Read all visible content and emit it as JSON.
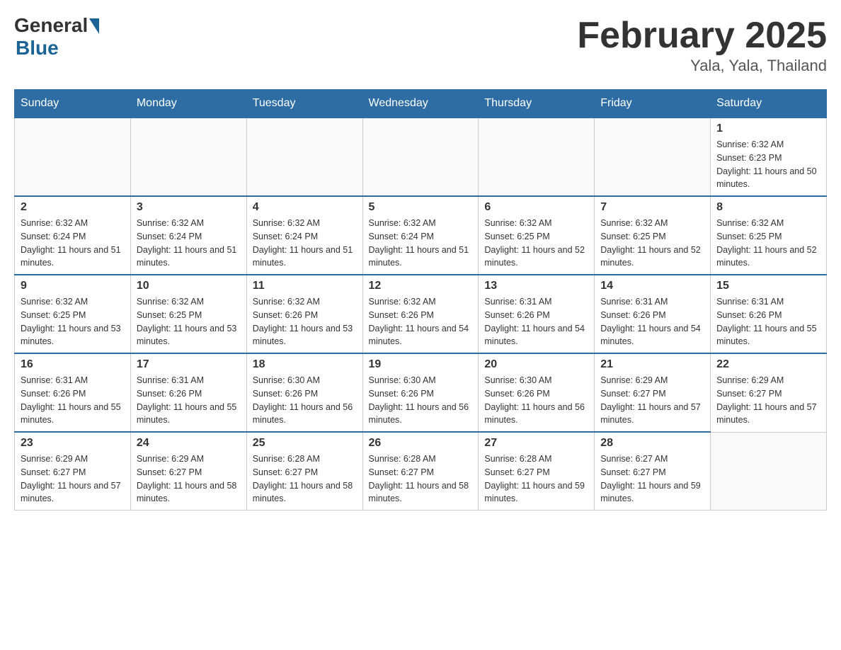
{
  "header": {
    "logo_general": "General",
    "logo_blue": "Blue",
    "month_title": "February 2025",
    "location": "Yala, Yala, Thailand"
  },
  "days_of_week": [
    "Sunday",
    "Monday",
    "Tuesday",
    "Wednesday",
    "Thursday",
    "Friday",
    "Saturday"
  ],
  "weeks": [
    [
      {
        "day": "",
        "info": ""
      },
      {
        "day": "",
        "info": ""
      },
      {
        "day": "",
        "info": ""
      },
      {
        "day": "",
        "info": ""
      },
      {
        "day": "",
        "info": ""
      },
      {
        "day": "",
        "info": ""
      },
      {
        "day": "1",
        "info": "Sunrise: 6:32 AM\nSunset: 6:23 PM\nDaylight: 11 hours and 50 minutes."
      }
    ],
    [
      {
        "day": "2",
        "info": "Sunrise: 6:32 AM\nSunset: 6:24 PM\nDaylight: 11 hours and 51 minutes."
      },
      {
        "day": "3",
        "info": "Sunrise: 6:32 AM\nSunset: 6:24 PM\nDaylight: 11 hours and 51 minutes."
      },
      {
        "day": "4",
        "info": "Sunrise: 6:32 AM\nSunset: 6:24 PM\nDaylight: 11 hours and 51 minutes."
      },
      {
        "day": "5",
        "info": "Sunrise: 6:32 AM\nSunset: 6:24 PM\nDaylight: 11 hours and 51 minutes."
      },
      {
        "day": "6",
        "info": "Sunrise: 6:32 AM\nSunset: 6:25 PM\nDaylight: 11 hours and 52 minutes."
      },
      {
        "day": "7",
        "info": "Sunrise: 6:32 AM\nSunset: 6:25 PM\nDaylight: 11 hours and 52 minutes."
      },
      {
        "day": "8",
        "info": "Sunrise: 6:32 AM\nSunset: 6:25 PM\nDaylight: 11 hours and 52 minutes."
      }
    ],
    [
      {
        "day": "9",
        "info": "Sunrise: 6:32 AM\nSunset: 6:25 PM\nDaylight: 11 hours and 53 minutes."
      },
      {
        "day": "10",
        "info": "Sunrise: 6:32 AM\nSunset: 6:25 PM\nDaylight: 11 hours and 53 minutes."
      },
      {
        "day": "11",
        "info": "Sunrise: 6:32 AM\nSunset: 6:26 PM\nDaylight: 11 hours and 53 minutes."
      },
      {
        "day": "12",
        "info": "Sunrise: 6:32 AM\nSunset: 6:26 PM\nDaylight: 11 hours and 54 minutes."
      },
      {
        "day": "13",
        "info": "Sunrise: 6:31 AM\nSunset: 6:26 PM\nDaylight: 11 hours and 54 minutes."
      },
      {
        "day": "14",
        "info": "Sunrise: 6:31 AM\nSunset: 6:26 PM\nDaylight: 11 hours and 54 minutes."
      },
      {
        "day": "15",
        "info": "Sunrise: 6:31 AM\nSunset: 6:26 PM\nDaylight: 11 hours and 55 minutes."
      }
    ],
    [
      {
        "day": "16",
        "info": "Sunrise: 6:31 AM\nSunset: 6:26 PM\nDaylight: 11 hours and 55 minutes."
      },
      {
        "day": "17",
        "info": "Sunrise: 6:31 AM\nSunset: 6:26 PM\nDaylight: 11 hours and 55 minutes."
      },
      {
        "day": "18",
        "info": "Sunrise: 6:30 AM\nSunset: 6:26 PM\nDaylight: 11 hours and 56 minutes."
      },
      {
        "day": "19",
        "info": "Sunrise: 6:30 AM\nSunset: 6:26 PM\nDaylight: 11 hours and 56 minutes."
      },
      {
        "day": "20",
        "info": "Sunrise: 6:30 AM\nSunset: 6:26 PM\nDaylight: 11 hours and 56 minutes."
      },
      {
        "day": "21",
        "info": "Sunrise: 6:29 AM\nSunset: 6:27 PM\nDaylight: 11 hours and 57 minutes."
      },
      {
        "day": "22",
        "info": "Sunrise: 6:29 AM\nSunset: 6:27 PM\nDaylight: 11 hours and 57 minutes."
      }
    ],
    [
      {
        "day": "23",
        "info": "Sunrise: 6:29 AM\nSunset: 6:27 PM\nDaylight: 11 hours and 57 minutes."
      },
      {
        "day": "24",
        "info": "Sunrise: 6:29 AM\nSunset: 6:27 PM\nDaylight: 11 hours and 58 minutes."
      },
      {
        "day": "25",
        "info": "Sunrise: 6:28 AM\nSunset: 6:27 PM\nDaylight: 11 hours and 58 minutes."
      },
      {
        "day": "26",
        "info": "Sunrise: 6:28 AM\nSunset: 6:27 PM\nDaylight: 11 hours and 58 minutes."
      },
      {
        "day": "27",
        "info": "Sunrise: 6:28 AM\nSunset: 6:27 PM\nDaylight: 11 hours and 59 minutes."
      },
      {
        "day": "28",
        "info": "Sunrise: 6:27 AM\nSunset: 6:27 PM\nDaylight: 11 hours and 59 minutes."
      },
      {
        "day": "",
        "info": ""
      }
    ]
  ]
}
